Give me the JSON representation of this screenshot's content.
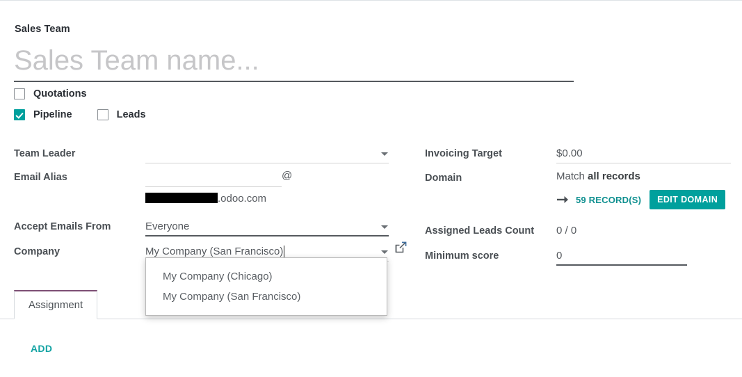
{
  "form": {
    "title_label": "Sales Team",
    "name_placeholder": "Sales Team name...",
    "checkboxes": [
      {
        "label": "Quotations",
        "checked": false
      },
      {
        "label": "Pipeline",
        "checked": true
      },
      {
        "label": "Leads",
        "checked": false
      }
    ],
    "left_fields": {
      "team_leader": {
        "label": "Team Leader",
        "value": ""
      },
      "email_alias": {
        "label": "Email Alias",
        "value": "",
        "at_symbol": "@",
        "domain_suffix": ".odoo.com"
      },
      "accept_emails_from": {
        "label": "Accept Emails From",
        "value": "Everyone"
      },
      "company": {
        "label": "Company",
        "value": "My Company (San Francisco)"
      }
    },
    "right_fields": {
      "invoicing_target": {
        "label": "Invoicing Target",
        "value": "$0.00"
      },
      "domain": {
        "label": "Domain",
        "match_prefix": "Match ",
        "match_strong": "all records",
        "records_link": "59 RECORD(S)",
        "edit_button": "EDIT DOMAIN"
      },
      "assigned_leads_count": {
        "label": "Assigned Leads Count",
        "value": "0 / 0"
      },
      "minimum_score": {
        "label": "Minimum score",
        "value": "0"
      }
    }
  },
  "dropdown": {
    "options": [
      "My Company (Chicago)",
      "My Company (San Francisco)"
    ]
  },
  "tabs": {
    "items": [
      {
        "label": "Assignment",
        "active": true
      }
    ],
    "add_label": "ADD"
  },
  "colors": {
    "accent_teal": "#00a09d",
    "link_teal": "#0d8f8f",
    "tab_active_border": "#7d4f74",
    "text_dark": "#2a2e34",
    "text_muted": "#55595e"
  }
}
